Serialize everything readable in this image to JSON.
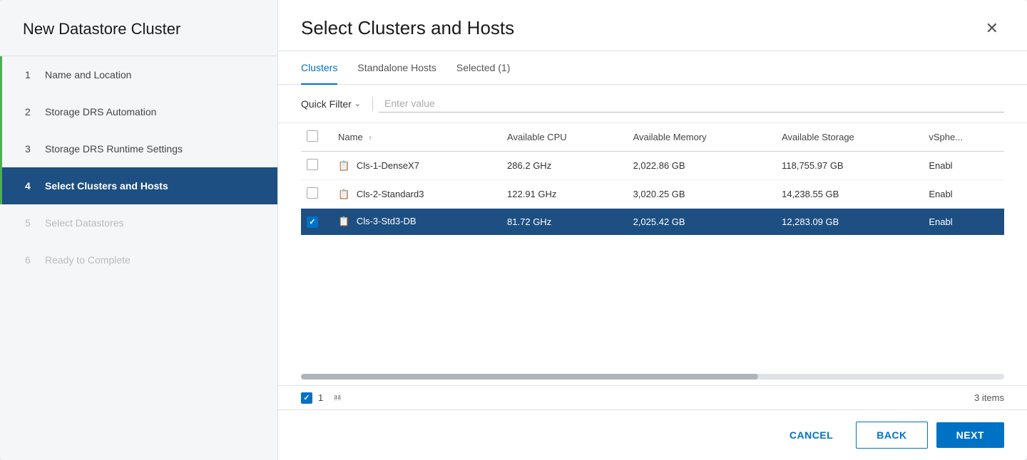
{
  "sidebar": {
    "title": "New Datastore Cluster",
    "steps": [
      {
        "num": "1",
        "label": "Name and Location",
        "state": "completed"
      },
      {
        "num": "2",
        "label": "Storage DRS Automation",
        "state": "completed"
      },
      {
        "num": "3",
        "label": "Storage DRS Runtime Settings",
        "state": "completed"
      },
      {
        "num": "4",
        "label": "Select Clusters and Hosts",
        "state": "active"
      },
      {
        "num": "5",
        "label": "Select Datastores",
        "state": "disabled"
      },
      {
        "num": "6",
        "label": "Ready to Complete",
        "state": "disabled"
      }
    ]
  },
  "main": {
    "title": "Select Clusters and Hosts",
    "tabs": [
      {
        "id": "clusters",
        "label": "Clusters",
        "active": true
      },
      {
        "id": "standalone-hosts",
        "label": "Standalone Hosts",
        "active": false
      },
      {
        "id": "selected",
        "label": "Selected (1)",
        "active": false
      }
    ],
    "filter": {
      "dropdown_label": "Quick Filter",
      "input_placeholder": "Enter value"
    },
    "table": {
      "columns": [
        {
          "id": "name",
          "label": "Name",
          "sortable": true
        },
        {
          "id": "cpu",
          "label": "Available CPU",
          "sortable": false
        },
        {
          "id": "memory",
          "label": "Available Memory",
          "sortable": false
        },
        {
          "id": "storage",
          "label": "Available Storage",
          "sortable": false
        },
        {
          "id": "vsphere",
          "label": "vSphe...",
          "sortable": false
        }
      ],
      "rows": [
        {
          "id": "row1",
          "name": "Cls-1-DenseX7",
          "cpu": "286.2 GHz",
          "memory": "2,022.86 GB",
          "storage": "118,755.97 GB",
          "vsphere": "Enabl",
          "checked": false,
          "selected": false
        },
        {
          "id": "row2",
          "name": "Cls-2-Standard3",
          "cpu": "122.91 GHz",
          "memory": "3,020.25 GB",
          "storage": "14,238.55 GB",
          "vsphere": "Enabl",
          "checked": false,
          "selected": false
        },
        {
          "id": "row3",
          "name": "Cls-3-Std3-DB",
          "cpu": "81.72 GHz",
          "memory": "2,025.42 GB",
          "storage": "12,283.09 GB",
          "vsphere": "Enabl",
          "checked": true,
          "selected": true
        }
      ]
    },
    "footer": {
      "selected_count": "1",
      "items_count": "3 items"
    },
    "buttons": {
      "cancel": "CANCEL",
      "back": "BACK",
      "next": "NEXT"
    }
  }
}
